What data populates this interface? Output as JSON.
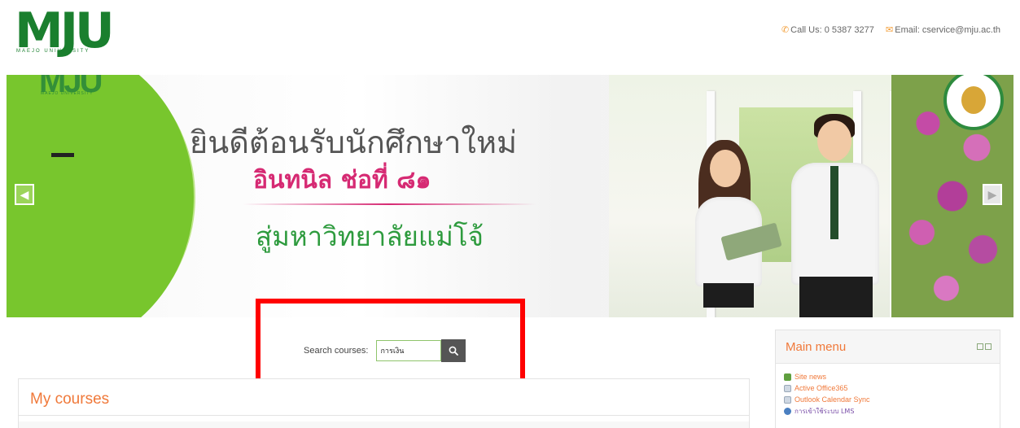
{
  "header": {
    "logo_text": "MJU",
    "logo_subtext": "MAEJO   UNIVERSITY",
    "phone": "Call Us: 0 5387 3277",
    "email": "Email: cservice@mju.ac.th"
  },
  "banner": {
    "mark_text": "MJU",
    "mark_subtext": "MAEJO UNIVERSITY",
    "line1": "ยินดีต้อนรับนักศึกษาใหม่",
    "line2": "อินทนิล ช่อที่ ๘๑",
    "line3": "สู่มหาวิทยาลัยแม่โจ้"
  },
  "search": {
    "label": "Search courses:",
    "value": "การเงิน"
  },
  "courses": {
    "title": "My courses"
  },
  "main_menu": {
    "title": "Main menu",
    "items": [
      {
        "label": "Site news",
        "icon": "forum-icon"
      },
      {
        "label": "Active Office365",
        "icon": "page-icon"
      },
      {
        "label": "Outlook Calendar Sync",
        "icon": "page-icon"
      },
      {
        "label": "การเข้าใช้ระบบ LMS",
        "icon": "url-icon"
      }
    ]
  },
  "colors": {
    "brand_green": "#1a7f2e",
    "accent_orange": "#f0793a",
    "highlight_red": "#ff0000"
  }
}
